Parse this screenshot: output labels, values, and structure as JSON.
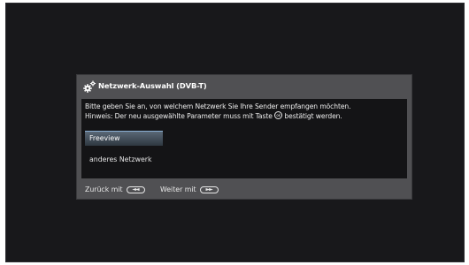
{
  "dialog": {
    "title": "Netzwerk-Auswahl (DVB-T)",
    "header_icon": "gear-icon",
    "instruction_line1": "Bitte geben Sie an, von welchem Netzwerk Sie Ihre Sender empfangen möchten.",
    "instruction_line2_before": "Hinweis: Der neu ausgewählte Parameter muss mit Taste ",
    "instruction_line2_after": " bestätigt werden.",
    "ok_key_icon": "ok-key-icon",
    "options": [
      {
        "label": "Freeview",
        "selected": true
      },
      {
        "label": "anderes Netzwerk",
        "selected": false
      }
    ],
    "footer": {
      "back_label": "Zurück mit",
      "back_key_icon": "rewind-key-icon",
      "back_key_glyph": "◄◄",
      "next_label": "Weiter mit",
      "next_key_icon": "fast-forward-key-icon",
      "next_key_glyph": "►►"
    }
  },
  "colors": {
    "screen_background": "#18181b",
    "dialog_frame": "#505053",
    "dialog_body": "#141416",
    "selection_highlight": "#5a6876",
    "selection_border": "#8ab0d6",
    "text": "#ececec"
  }
}
